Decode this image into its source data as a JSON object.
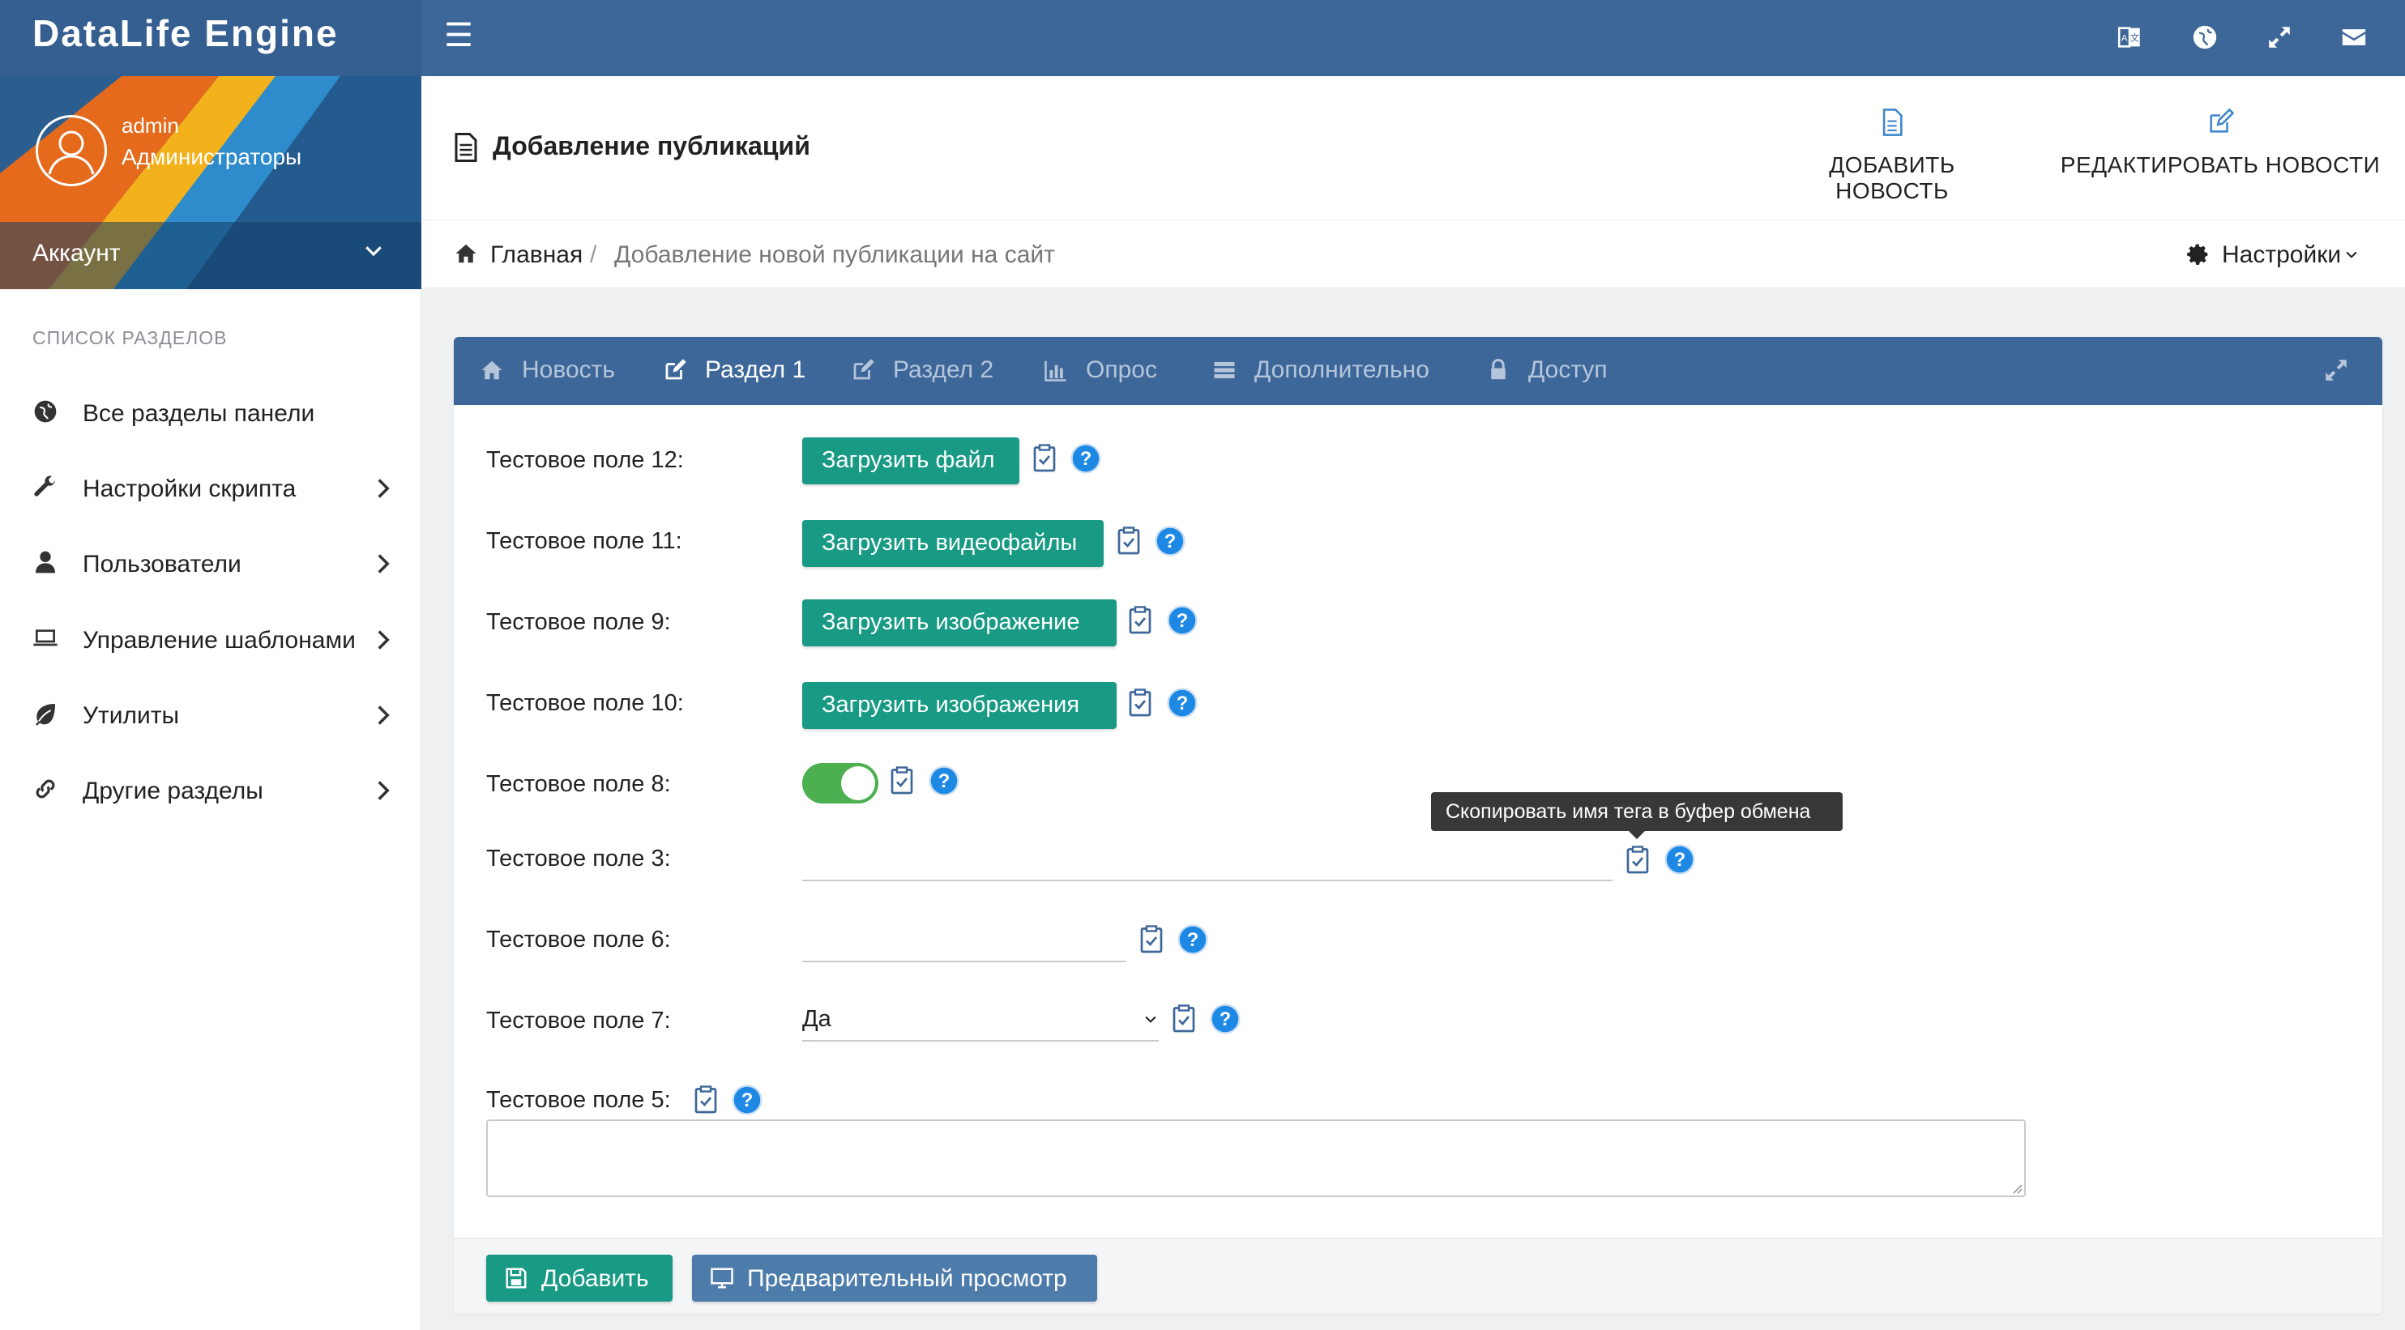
{
  "app": {
    "title": "DataLife Engine"
  },
  "topbar": {
    "menu_icon": "hamburger-icon",
    "icons": [
      "language-icon",
      "globe-icon",
      "fullscreen-icon",
      "envelope-icon"
    ]
  },
  "user": {
    "name": "admin",
    "group": "Администраторы",
    "account_label": "Аккаунт"
  },
  "sidebar": {
    "header": "СПИСОК РАЗДЕЛОВ",
    "items": [
      {
        "label": "Все разделы панели",
        "icon": "globe-icon"
      },
      {
        "label": "Настройки скрипта",
        "icon": "wrench-icon"
      },
      {
        "label": "Пользователи",
        "icon": "user-icon"
      },
      {
        "label": "Управление шаблонами",
        "icon": "laptop-icon"
      },
      {
        "label": "Утилиты",
        "icon": "leaf-icon"
      },
      {
        "label": "Другие разделы",
        "icon": "link-icon"
      }
    ]
  },
  "header": {
    "title": "Добавление публикаций",
    "add_news": "ДОБАВИТЬ НОВОСТЬ",
    "edit_news": "РЕДАКТИРОВАТЬ НОВОСТИ"
  },
  "breadcrumb": {
    "home": "Главная",
    "separator": "/",
    "current": "Добавление новой публикации на сайт",
    "settings": "Настройки"
  },
  "tabs": [
    {
      "label": "Новость",
      "icon": "home-icon",
      "active": false
    },
    {
      "label": "Раздел 1",
      "icon": "edit-icon",
      "active": true
    },
    {
      "label": "Раздел 2",
      "icon": "edit-icon",
      "active": false
    },
    {
      "label": "Опрос",
      "icon": "bar-chart-icon",
      "active": false
    },
    {
      "label": "Дополнительно",
      "icon": "list-icon",
      "active": false
    },
    {
      "label": "Доступ",
      "icon": "lock-icon",
      "active": false
    }
  ],
  "fields": {
    "f12": {
      "label": "Тестовое поле 12:",
      "button": "Загрузить файл"
    },
    "f11": {
      "label": "Тестовое поле 11:",
      "button": "Загрузить видеофайлы"
    },
    "f9": {
      "label": "Тестовое поле 9:",
      "button": "Загрузить изображение"
    },
    "f10": {
      "label": "Тестовое поле 10:",
      "button": "Загрузить изображения"
    },
    "f8": {
      "label": "Тестовое поле 8:",
      "toggle_on": true
    },
    "f3": {
      "label": "Тестовое поле 3:",
      "value": ""
    },
    "f6": {
      "label": "Тестовое поле 6:",
      "value": ""
    },
    "f7": {
      "label": "Тестовое поле 7:",
      "selected": "Да"
    },
    "f5": {
      "label": "Тестовое поле 5:",
      "value": ""
    }
  },
  "tooltip": {
    "text": "Скопировать имя тега в буфер обмена"
  },
  "footer": {
    "add": "Добавить",
    "preview": "Предварительный просмотр"
  },
  "colors": {
    "header_blue": "#3e6799",
    "green_button": "#189a84",
    "toggle_green": "#4caf50",
    "help_blue": "#1e88e5",
    "preview_button": "#4d7cab"
  }
}
